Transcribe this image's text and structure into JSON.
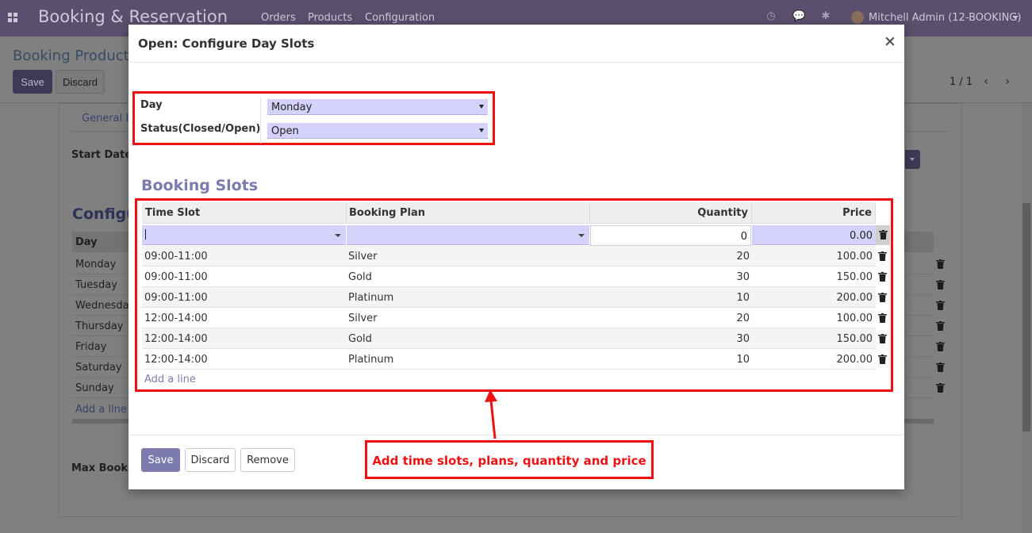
{
  "navbar": {
    "brand": "Booking & Reservation",
    "menu": [
      "Orders",
      "Products",
      "Configuration"
    ],
    "user": "Mitchell Admin (12-BOOKING)"
  },
  "control_panel": {
    "breadcrumb": "Booking Products",
    "save_label": "Save",
    "discard_label": "Discard",
    "pager": "1 / 1"
  },
  "background_form": {
    "tab": "General In",
    "start_date_label": "Start Date",
    "section_heading": "Configu",
    "day_header": "Day",
    "days": [
      "Monday",
      "Tuesday",
      "Wednesday",
      "Thursday",
      "Friday",
      "Saturday",
      "Sunday"
    ],
    "add_line": "Add a line",
    "max_booking_label": "Max Booking"
  },
  "modal": {
    "title": "Open: Configure Day Slots",
    "close": "×",
    "day_label": "Day",
    "day_value": "Monday",
    "status_label": "Status(Closed/Open)",
    "status_value": "Open",
    "section_title": "Booking Slots",
    "columns": {
      "time_slot": "Time Slot",
      "booking_plan": "Booking Plan",
      "quantity": "Quantity",
      "price": "Price"
    },
    "edit_row": {
      "time_slot": "",
      "booking_plan": "",
      "quantity": "0",
      "price": "0.00"
    },
    "rows": [
      {
        "time_slot": "09:00-11:00",
        "plan": "Silver",
        "quantity": "20",
        "price": "100.00"
      },
      {
        "time_slot": "09:00-11:00",
        "plan": "Gold",
        "quantity": "30",
        "price": "150.00"
      },
      {
        "time_slot": "09:00-11:00",
        "plan": "Platinum",
        "quantity": "10",
        "price": "200.00"
      },
      {
        "time_slot": "12:00-14:00",
        "plan": "Silver",
        "quantity": "20",
        "price": "100.00"
      },
      {
        "time_slot": "12:00-14:00",
        "plan": "Gold",
        "quantity": "30",
        "price": "150.00"
      },
      {
        "time_slot": "12:00-14:00",
        "plan": "Platinum",
        "quantity": "10",
        "price": "200.00"
      }
    ],
    "add_line": "Add a line",
    "buttons": {
      "save": "Save",
      "discard": "Discard",
      "remove": "Remove"
    }
  },
  "annotation": {
    "callout": "Add time slots, plans, quantity and price",
    "color": "#ee1111"
  },
  "colors": {
    "accent": "#7c7bad",
    "navbar": "#5a4f6d",
    "select_bg": "#d4d2fb"
  }
}
